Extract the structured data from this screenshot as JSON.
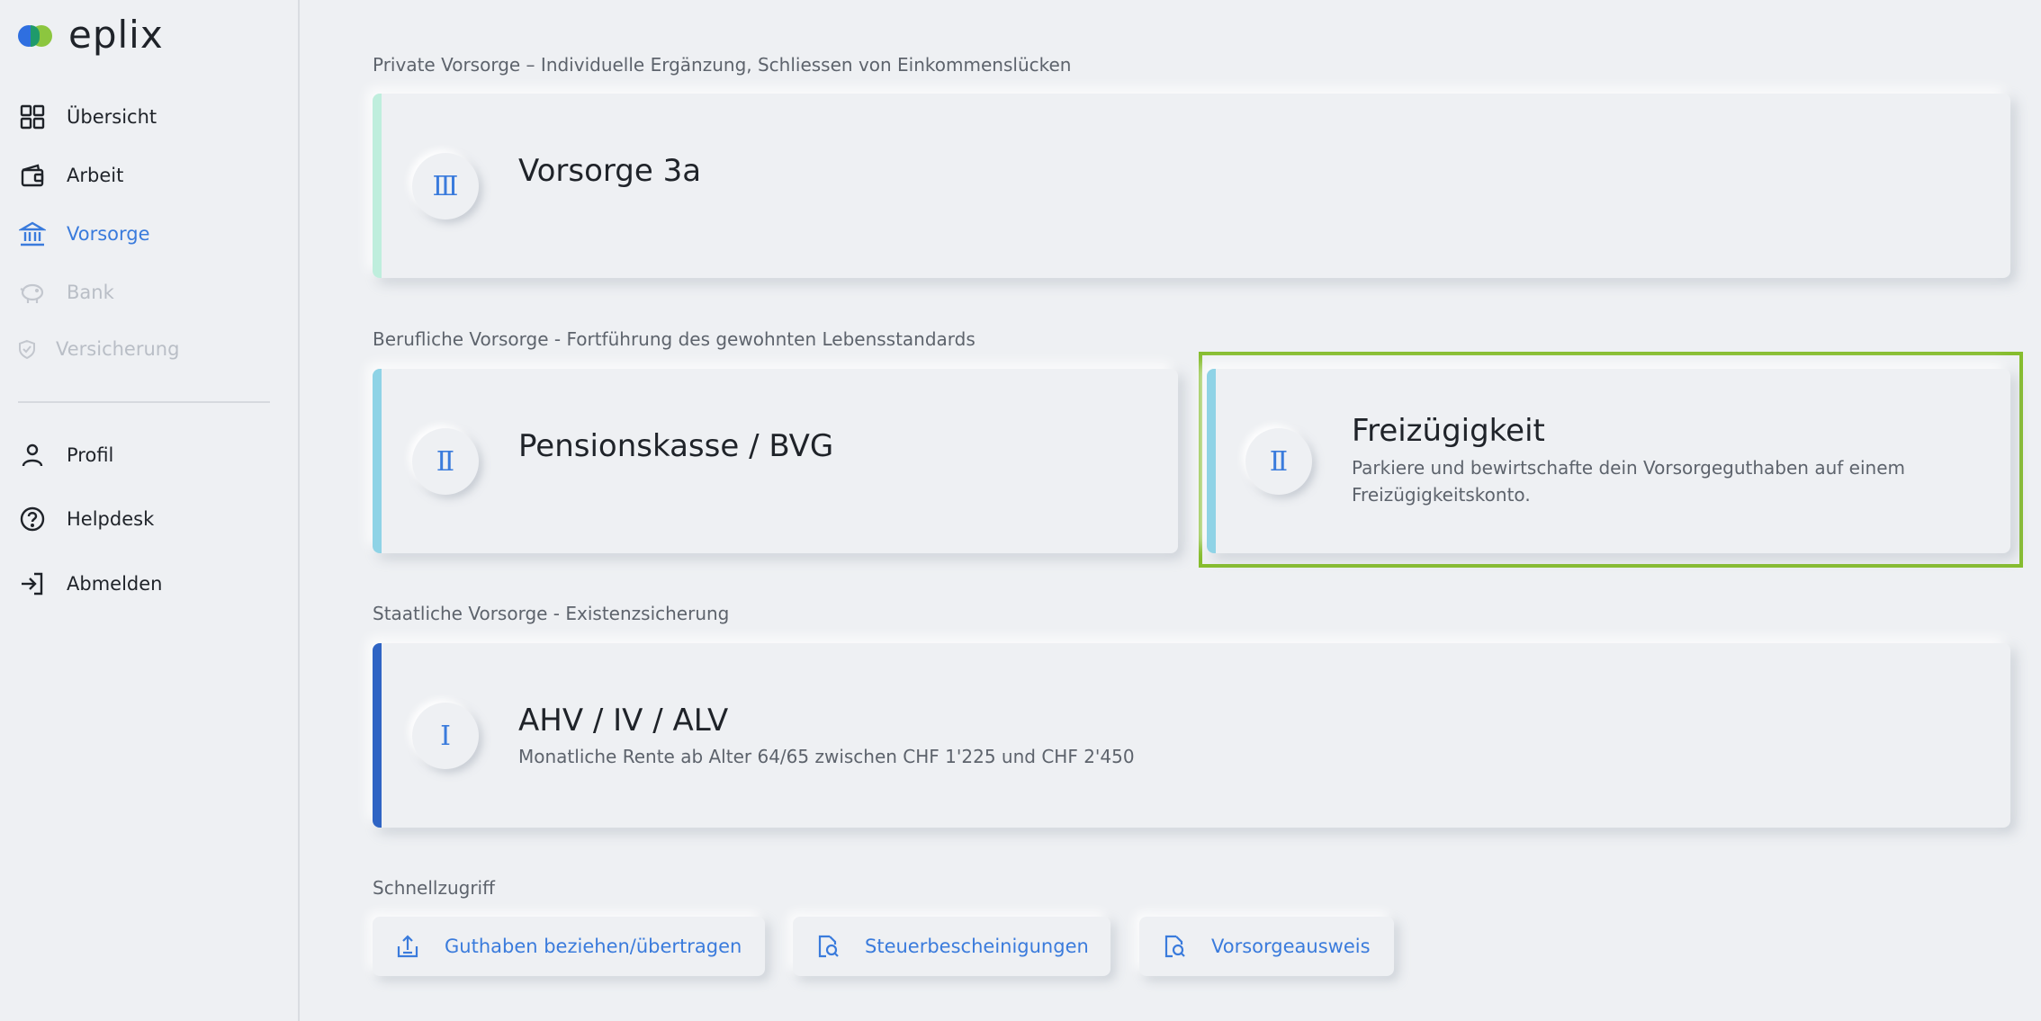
{
  "brand": {
    "name": "eplix",
    "accent": "#3a7bdc",
    "green": "#86bd2e"
  },
  "sidebar": {
    "items": [
      {
        "label": "Übersicht",
        "icon": "grid-icon",
        "state": "normal"
      },
      {
        "label": "Arbeit",
        "icon": "wallet-icon",
        "state": "normal"
      },
      {
        "label": "Vorsorge",
        "icon": "bank-icon",
        "state": "active"
      },
      {
        "label": "Bank",
        "icon": "piggy-bank-icon",
        "state": "disabled"
      },
      {
        "label": "Versicherung",
        "icon": "shield-icon",
        "state": "disabled"
      }
    ],
    "secondary": [
      {
        "label": "Profil",
        "icon": "user-icon"
      },
      {
        "label": "Helpdesk",
        "icon": "help-icon"
      },
      {
        "label": "Abmelden",
        "icon": "logout-icon"
      }
    ]
  },
  "sections": {
    "private": {
      "title": "Private Vorsorge – Individuelle Ergänzung, Schliessen von Einkommenslücken",
      "card": {
        "badge": "Ⅲ",
        "title": "Vorsorge 3a",
        "stripe": "#bfeedd"
      }
    },
    "occupational": {
      "title": "Berufliche Vorsorge - Fortführung des gewohnten Lebensstandards",
      "cards": [
        {
          "badge": "Ⅱ",
          "title": "Pensionskasse / BVG",
          "stripe": "#8fd3e6"
        },
        {
          "badge": "Ⅱ",
          "title": "Freizügigkeit",
          "description": "Parkiere und bewirtschafte dein Vorsorgeguthaben auf einem Freizügigkeitskonto.",
          "stripe": "#8fd3e6"
        }
      ]
    },
    "state": {
      "title": "Staatliche Vorsorge - Existenzsicherung",
      "card": {
        "badge": "Ⅰ",
        "title": "AHV / IV / ALV",
        "description": "Monatliche Rente ab Alter 64/65 zwischen CHF 1'225 und CHF 2'450",
        "stripe": "#2f64c4"
      }
    }
  },
  "quickaccess": {
    "title": "Schnellzugriff",
    "items": [
      {
        "label": "Guthaben beziehen/übertragen",
        "icon": "upload-icon"
      },
      {
        "label": "Steuerbescheinigungen",
        "icon": "document-search-icon"
      },
      {
        "label": "Vorsorgeausweis",
        "icon": "document-search-icon"
      }
    ]
  }
}
